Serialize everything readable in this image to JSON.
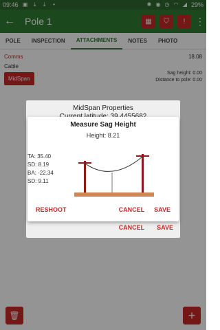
{
  "status_bar": {
    "time": "09:46",
    "battery": "29%",
    "left_icons": [
      "image-icon",
      "download-icon",
      "download-icon",
      "dot-icon"
    ],
    "right_icons": [
      "bluetooth-icon",
      "location-icon",
      "alarm-icon",
      "wifi-icon",
      "signal-icon"
    ]
  },
  "app_bar": {
    "title": "Pole 1",
    "actions": [
      "map-icon",
      "shield-icon",
      "alert-icon"
    ]
  },
  "tabs": [
    {
      "label": "POLE",
      "active": false
    },
    {
      "label": "INSPECTION",
      "active": false
    },
    {
      "label": "ATTACHMENTS",
      "active": true
    },
    {
      "label": "NOTES",
      "active": false
    },
    {
      "label": "PHOTO",
      "active": false
    }
  ],
  "attachments": {
    "comms_label": "Comms",
    "comms_value": "18.08",
    "cable_label": "Cable",
    "midspan_label": "MidSpan",
    "sag_height": "Sag height: 0.00",
    "distance_to_pole": "Distance to pole: 0.00"
  },
  "midspan_properties": {
    "title": "MidSpan Properties",
    "latitude": "Current latitude: 39.4455682",
    "cancel": "CANCEL",
    "save": "SAVE"
  },
  "measure_dialog": {
    "title": "Measure Sag Height",
    "height": "Height: 8.21",
    "measurements": [
      "TA: 35.40",
      "SD: 8.19",
      "BA: -22.34",
      "SD: 9.11"
    ],
    "reshoot": "RESHOOT",
    "cancel": "CANCEL",
    "save": "SAVE"
  },
  "colors": {
    "status_bar": "#2f6a2f",
    "app_bar": "#2f7d32",
    "accent": "#c62828",
    "tab_active": "#2e7d32",
    "pole": "#8b1a1a",
    "ground": "#c9885a"
  },
  "fabs": {
    "delete_icon": "trash-icon",
    "add_label": "+"
  }
}
